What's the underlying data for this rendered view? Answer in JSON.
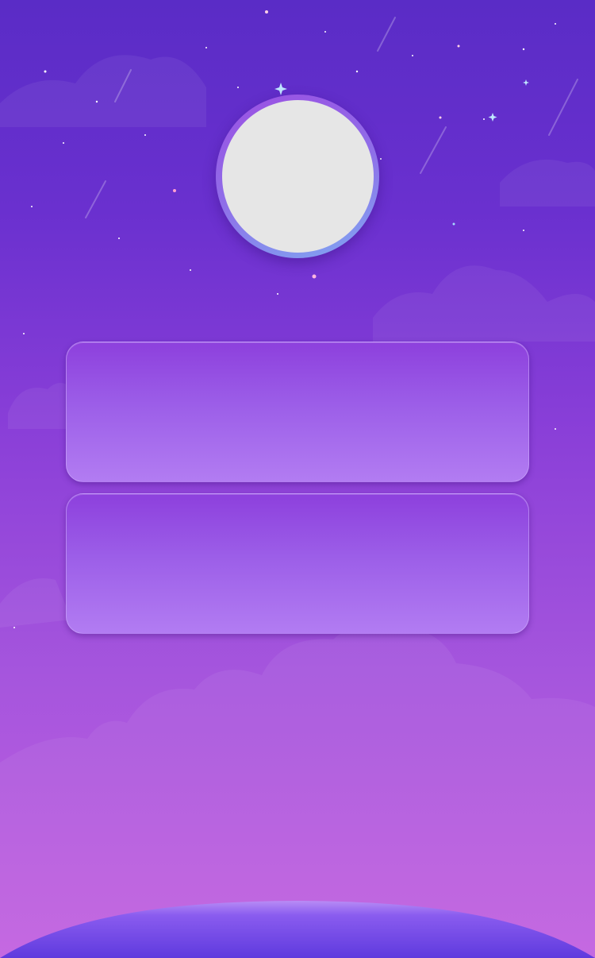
{
  "theme": {
    "background_top": "#5a2cc6",
    "background_bottom": "#c260e0",
    "card_color": "#9c5ee8",
    "avatar_placeholder": "#e6e6e6",
    "planet_color": "#6a3fe0"
  },
  "header": {
    "avatar_icon": "avatar-placeholder"
  },
  "panels": [
    {
      "name": "panel-1",
      "label": ""
    },
    {
      "name": "panel-2",
      "label": ""
    }
  ]
}
